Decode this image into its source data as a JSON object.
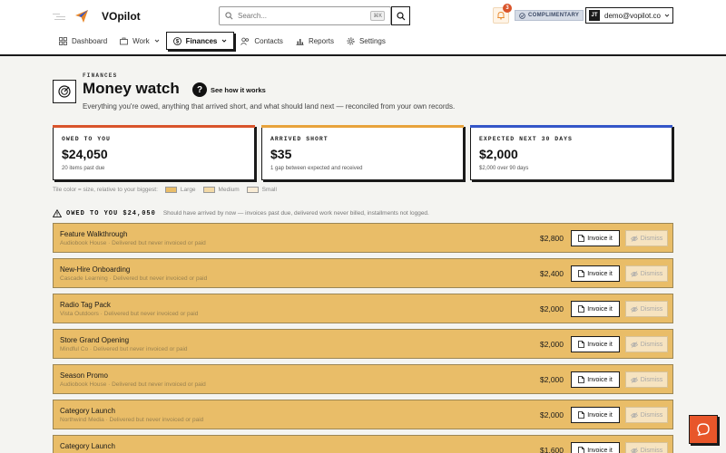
{
  "app": {
    "brand": "VOpilot"
  },
  "search": {
    "placeholder": "Search...",
    "shortcut": "⌘K"
  },
  "notifications": {
    "count": "3"
  },
  "plan": {
    "badge": "COMPLIMENTARY"
  },
  "user": {
    "initials": "JT",
    "email": "demo@vopilot.co"
  },
  "nav": [
    {
      "label": "Dashboard",
      "icon": "dashboard-icon"
    },
    {
      "label": "Work",
      "icon": "briefcase-icon"
    },
    {
      "label": "Finances",
      "icon": "dollar-icon",
      "active": true
    },
    {
      "label": "Contacts",
      "icon": "contacts-icon"
    },
    {
      "label": "Reports",
      "icon": "bar-chart-icon"
    },
    {
      "label": "Settings",
      "icon": "gear-icon"
    }
  ],
  "page": {
    "eyebrow": "FINANCES",
    "title": "Money watch",
    "help": "See how it works",
    "subtitle": "Everything you're owed, anything that arrived short, and what should land next — reconciled from your own records."
  },
  "cards": [
    {
      "label": "OWED TO YOU",
      "value": "$24,050",
      "note": "20 items past due",
      "color": "#d9542b"
    },
    {
      "label": "ARRIVED SHORT",
      "value": "$35",
      "note": "1 gap between expected and received",
      "color": "#e8a33c"
    },
    {
      "label": "EXPECTED NEXT 30 DAYS",
      "value": "$2,000",
      "note": "$2,000 over 90 days",
      "color": "#3456c8"
    }
  ],
  "legend": {
    "caption": "Tile color = size, relative to your biggest:",
    "items": [
      {
        "label": "Large",
        "color": "#e9bd68"
      },
      {
        "label": "Medium",
        "color": "#f2d9a6"
      },
      {
        "label": "Small",
        "color": "#f9ecd5"
      }
    ]
  },
  "section": {
    "title": "OWED TO YOU $24,050",
    "desc": "Should have arrived by now — invoices past due, delivered work never billed, installments not logged."
  },
  "actions": {
    "invoice": "Invoice it",
    "dismiss": "Dismiss"
  },
  "rows": [
    {
      "title": "Feature Walkthrough",
      "sub": "Audiobook House · Delivered but never invoiced or paid",
      "amount": "$2,800"
    },
    {
      "title": "New-Hire Onboarding",
      "sub": "Cascade Learning · Delivered but never invoiced or paid",
      "amount": "$2,400"
    },
    {
      "title": "Radio Tag Pack",
      "sub": "Vista Outdoors · Delivered but never invoiced or paid",
      "amount": "$2,000"
    },
    {
      "title": "Store Grand Opening",
      "sub": "Mindful Co · Delivered but never invoiced or paid",
      "amount": "$2,000"
    },
    {
      "title": "Season Promo",
      "sub": "Audiobook House · Delivered but never invoiced or paid",
      "amount": "$2,000"
    },
    {
      "title": "Category Launch",
      "sub": "Northwind Media · Delivered but never invoiced or paid",
      "amount": "$2,000"
    },
    {
      "title": "Category Launch",
      "sub": "",
      "amount": "$1,600"
    }
  ]
}
